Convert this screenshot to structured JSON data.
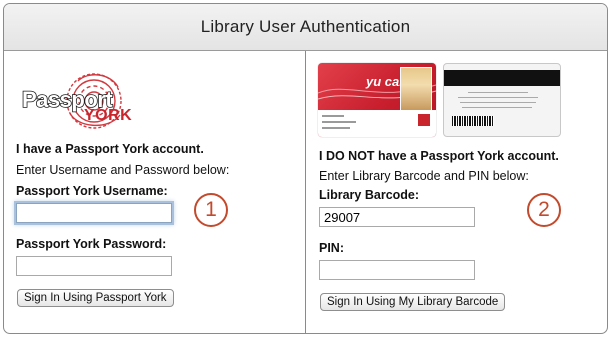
{
  "header": {
    "title": "Library User Authentication"
  },
  "passport": {
    "logo_text_main": "Passport",
    "logo_text_sub": "YORK",
    "account_heading": "I have a Passport York account.",
    "instruction": "Enter Username and Password below:",
    "username_label": "Passport York Username:",
    "username_value": "",
    "password_label": "Passport York Password:",
    "password_value": "",
    "submit_label": "Sign In Using Passport York",
    "step_number": "1"
  },
  "library": {
    "card_front_brand": "yu card",
    "account_heading": "I DO NOT have a Passport York account.",
    "instruction": "Enter Library Barcode and PIN below:",
    "barcode_label": "Library Barcode:",
    "barcode_value": "29007",
    "pin_label": "PIN:",
    "pin_value": "",
    "submit_label": "Sign In Using My Library Barcode",
    "step_number": "2"
  },
  "colors": {
    "accent_step": "#c34a2c",
    "card_red": "#c81e2d",
    "header_bg": "#e8e8e8",
    "border": "#8a8a8a"
  }
}
